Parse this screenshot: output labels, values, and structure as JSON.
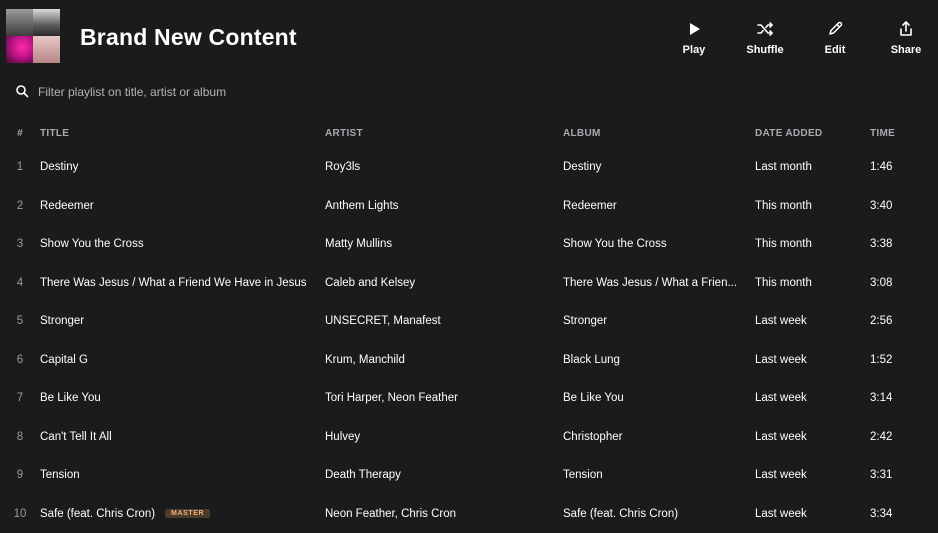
{
  "playlist": {
    "title": "Brand New Content",
    "cover_icon": "album-collage"
  },
  "actions": [
    {
      "label": "Play",
      "icon": "play-icon"
    },
    {
      "label": "Shuffle",
      "icon": "shuffle-icon"
    },
    {
      "label": "Edit",
      "icon": "edit-icon"
    },
    {
      "label": "Share",
      "icon": "share-icon"
    }
  ],
  "filter": {
    "placeholder": "Filter playlist on title, artist or album",
    "value": ""
  },
  "table": {
    "headers": {
      "num": "#",
      "title": "TITLE",
      "artist": "ARTIST",
      "album": "ALBUM",
      "date": "DATE ADDED",
      "time": "TIME"
    },
    "rows": [
      {
        "num": "1",
        "title": "Destiny",
        "badge": "",
        "artist": "Roy3ls",
        "album": "Destiny",
        "date": "Last month",
        "time": "1:46"
      },
      {
        "num": "2",
        "title": "Redeemer",
        "badge": "",
        "artist": "Anthem Lights",
        "album": "Redeemer",
        "date": "This month",
        "time": "3:40"
      },
      {
        "num": "3",
        "title": "Show You the Cross",
        "badge": "",
        "artist": "Matty Mullins",
        "album": "Show You the Cross",
        "date": "This month",
        "time": "3:38"
      },
      {
        "num": "4",
        "title": "There Was Jesus / What a Friend We Have in Jesus",
        "badge": "",
        "artist": "Caleb and Kelsey",
        "album": "There Was Jesus / What a Frien...",
        "date": "This month",
        "time": "3:08"
      },
      {
        "num": "5",
        "title": "Stronger",
        "badge": "",
        "artist": "UNSECRET, Manafest",
        "album": "Stronger",
        "date": "Last week",
        "time": "2:56"
      },
      {
        "num": "6",
        "title": "Capital G",
        "badge": "",
        "artist": "Krum, Manchild",
        "album": "Black Lung",
        "date": "Last week",
        "time": "1:52"
      },
      {
        "num": "7",
        "title": "Be Like You",
        "badge": "",
        "artist": "Tori Harper, Neon Feather",
        "album": "Be Like You",
        "date": "Last week",
        "time": "3:14"
      },
      {
        "num": "8",
        "title": "Can't Tell It All",
        "badge": "",
        "artist": "Hulvey",
        "album": "Christopher",
        "date": "Last week",
        "time": "2:42"
      },
      {
        "num": "9",
        "title": "Tension",
        "badge": "",
        "artist": "Death Therapy",
        "album": "Tension",
        "date": "Last week",
        "time": "3:31"
      },
      {
        "num": "10",
        "title": "Safe (feat. Chris Cron)",
        "badge": "MASTER",
        "artist": "Neon Feather, Chris Cron",
        "album": "Safe (feat. Chris Cron)",
        "date": "Last week",
        "time": "3:34"
      }
    ]
  },
  "colors": {
    "background": "#1b1b1d",
    "muted_text": "#a9a9ad",
    "badge_bg": "#4a3b2a",
    "badge_text": "#f2b27a"
  }
}
